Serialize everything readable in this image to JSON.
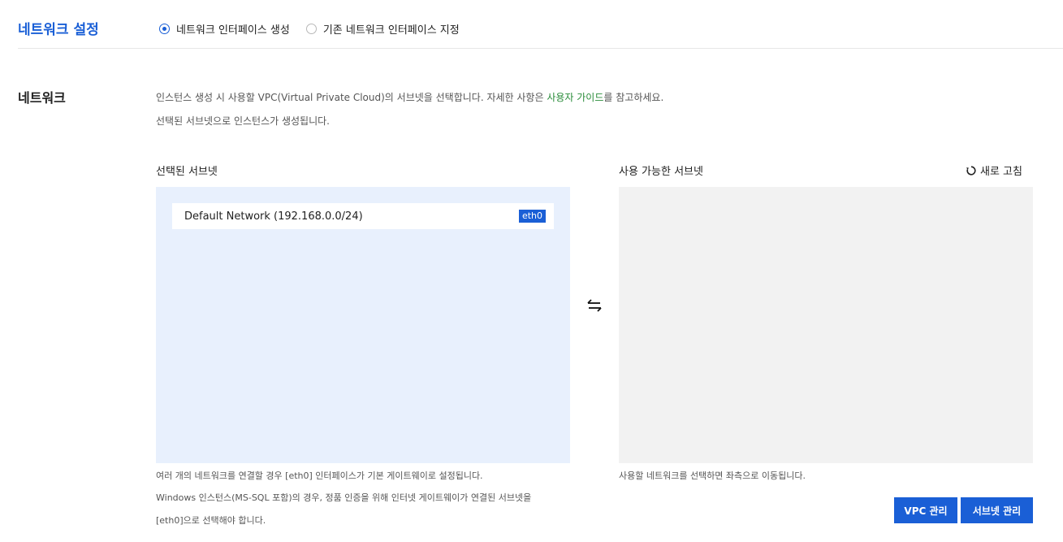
{
  "header": {
    "title": "네트워크 설정",
    "options": [
      {
        "label": "네트워크 인터페이스 생성",
        "checked": true
      },
      {
        "label": "기존 네트워크 인터페이스 지정",
        "checked": false
      }
    ]
  },
  "network": {
    "label": "네트워크",
    "desc_line1_before": "인스턴스 생성 시 사용할 VPC(Virtual Private Cloud)의 서브넷을 선택합니다. 자세한 사항은 ",
    "desc_link": "사용자 가이드",
    "desc_line1_after": "를 참고하세요.",
    "desc_line2": "선택된 서브넷으로 인스턴스가 생성됩니다."
  },
  "selected_panel": {
    "title": "선택된 서브넷",
    "items": [
      {
        "name": "Default Network (192.168.0.0/24)",
        "badge": "eth0"
      }
    ],
    "notes": [
      "여러 개의 네트워크를 연결할 경우 [eth0] 인터페이스가 기본 게이트웨이로 설정됩니다.",
      "Windows 인스턴스(MS-SQL 포함)의 경우, 정품 인증을 위해 인터넷 게이트웨이가 연결된 서브넷을",
      "[eth0]으로 선택해야 합니다."
    ]
  },
  "available_panel": {
    "title": "사용 가능한 서브넷",
    "refresh_label": "새로 고침",
    "note": "사용할 네트워크를 선택하면 좌측으로 이동됩니다."
  },
  "buttons": {
    "vpc": "VPC 관리",
    "subnet": "서브넷 관리"
  },
  "colors": {
    "accent": "#1a5fd6",
    "link": "#2a8c3a",
    "selected_bg": "#e8f0fd",
    "available_bg": "#f2f2f2"
  }
}
